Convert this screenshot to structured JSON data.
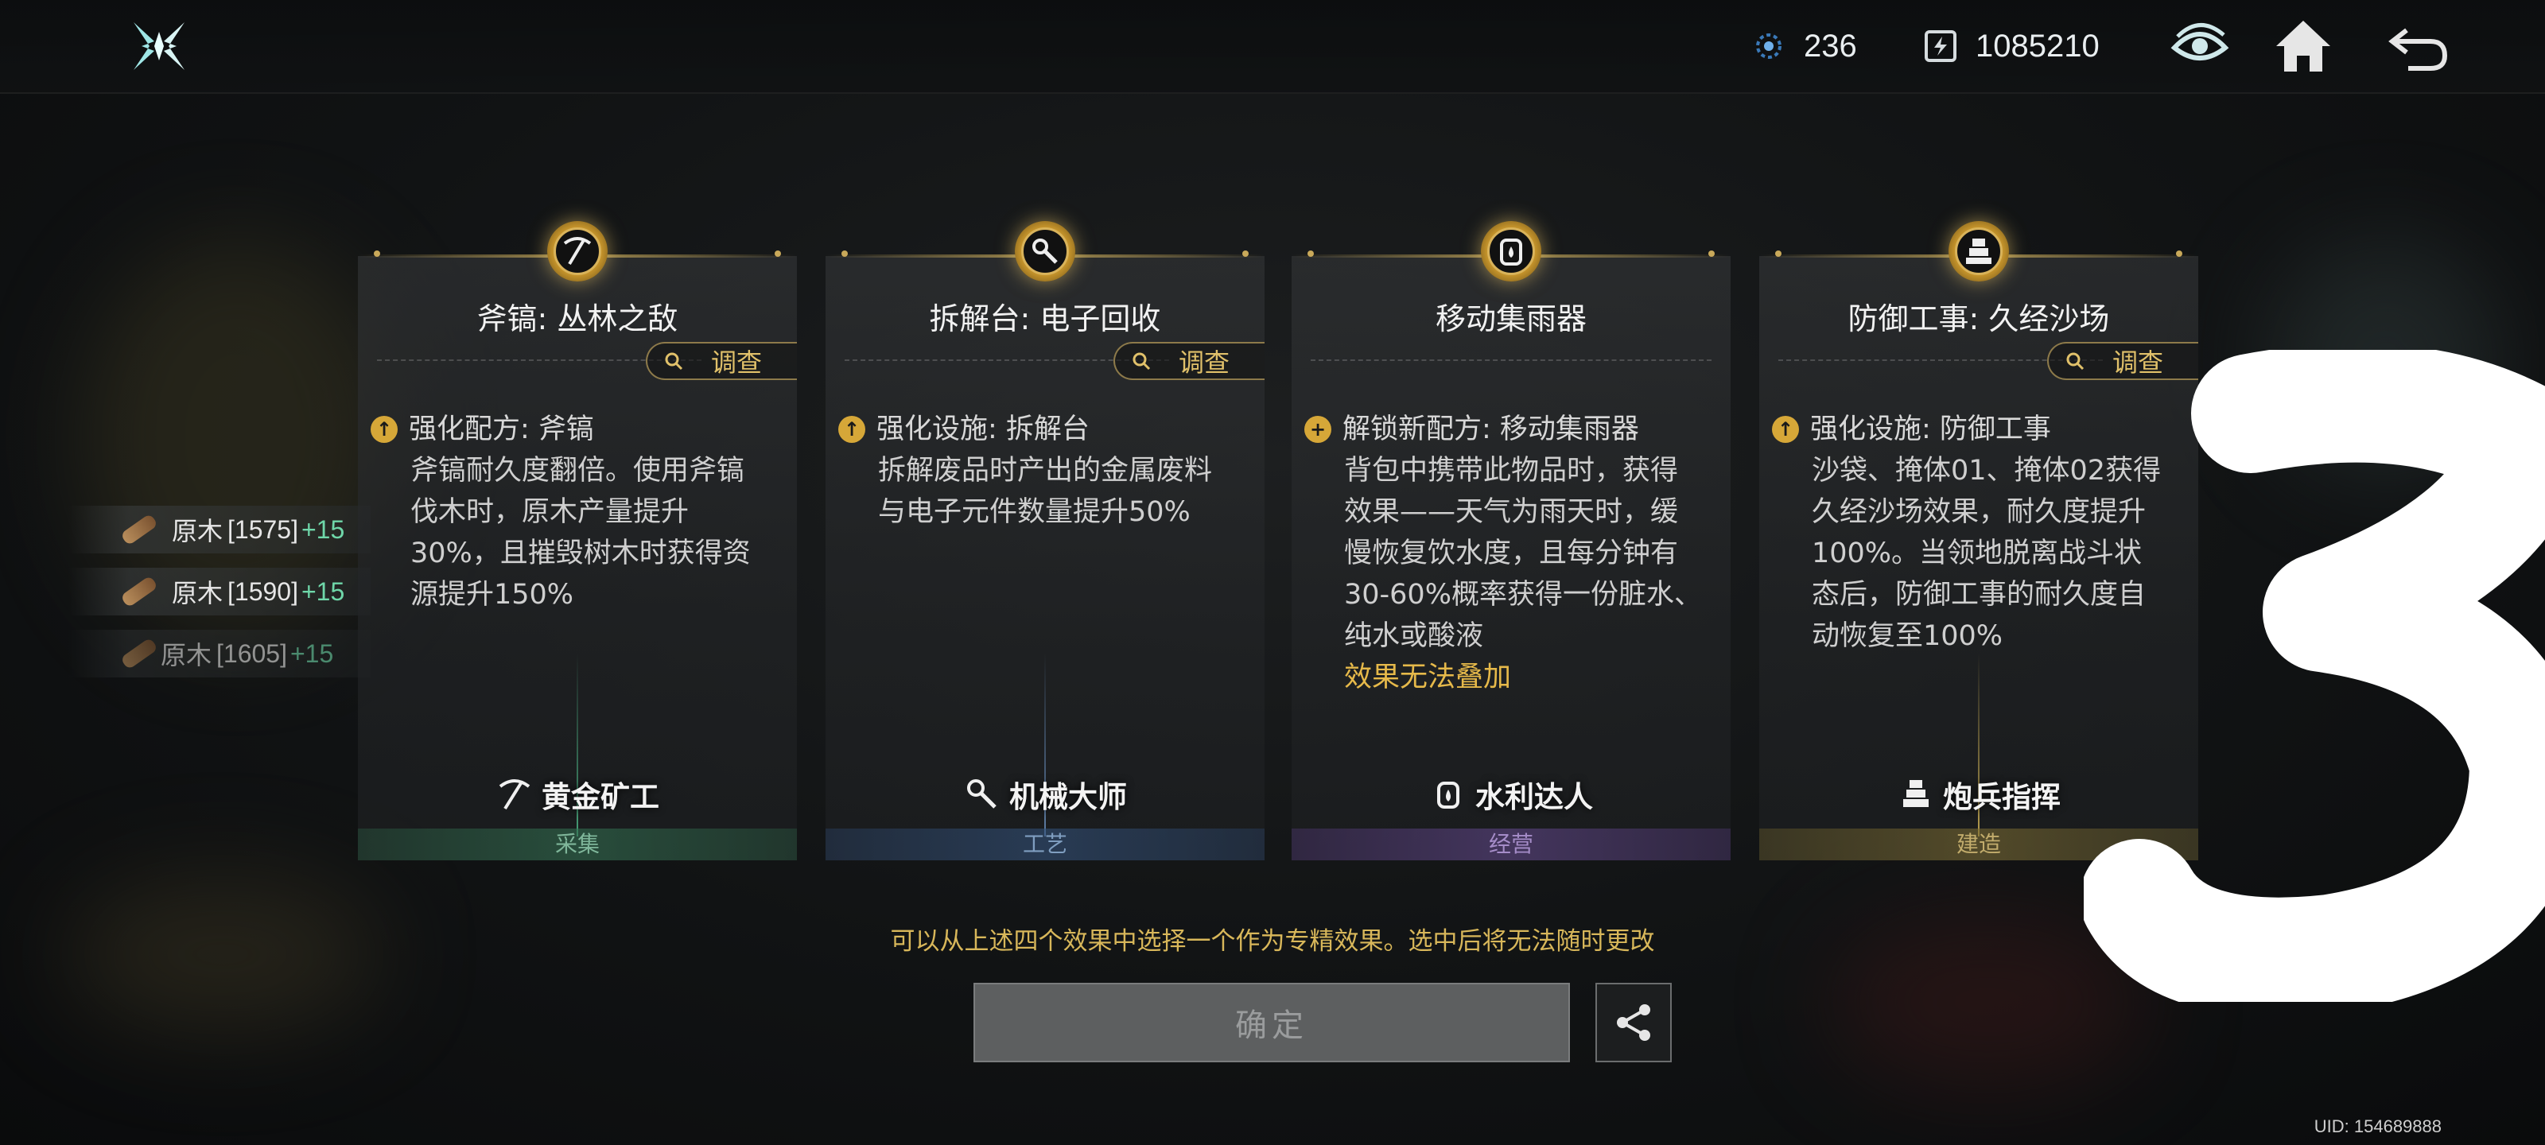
{
  "topbar": {
    "resources": [
      {
        "icon": "energy-crystal-icon",
        "value": "236"
      },
      {
        "icon": "currency-chip-icon",
        "value": "1085210"
      }
    ],
    "buttons": [
      "eye-icon",
      "home-icon",
      "back-icon"
    ]
  },
  "side_resources": [
    {
      "name": "原木",
      "level": "[1575]",
      "bonus": "+15"
    },
    {
      "name": "原木",
      "level": "[1590]",
      "bonus": "+15"
    },
    {
      "name": "原木",
      "level": "[1605]",
      "bonus": "+15"
    }
  ],
  "inspect_label": "调查",
  "cards": [
    {
      "title": "斧镐: 丛林之敌",
      "effect_head": "强化配方: 斧镐",
      "effect_body": "斧镐耐久度翻倍。使用斧镐伐木时，原木产量提升30%，且摧毁树木时获得资源提升150%",
      "warning": "",
      "role": "黄金矿工",
      "category": "采集",
      "accent": "#3f8a6b"
    },
    {
      "title": "拆解台: 电子回收",
      "effect_head": "强化设施: 拆解台",
      "effect_body": "拆解废品时产出的金属废料与电子元件数量提升50%",
      "warning": "",
      "role": "机械大师",
      "category": "工艺",
      "accent": "#4a6f93"
    },
    {
      "title": "移动集雨器",
      "effect_head": "解锁新配方: 移动集雨器",
      "effect_body": "背包中携带此物品时，获得效果——天气为雨天时，缓慢恢复饮水度，且每分钟有30-60%概率获得一份脏水、纯水或酸液",
      "warning": "效果无法叠加",
      "role": "水利达人",
      "category": "经营",
      "accent": "#7a5a9c"
    },
    {
      "title": "防御工事: 久经沙场",
      "effect_head": "强化设施: 防御工事",
      "effect_body": "沙袋、掩体01、掩体02获得久经沙场效果，耐久度提升100%。当领地脱离战斗状态后，防御工事的耐久度自动恢复至100%",
      "warning": "",
      "role": "炮兵指挥",
      "category": "建造",
      "accent": "#a08a3a"
    }
  ],
  "hint": "可以从上述四个效果中选择一个作为专精效果。选中后将无法随时更改",
  "confirm_label": "确定",
  "uid": "UID: 154689888"
}
